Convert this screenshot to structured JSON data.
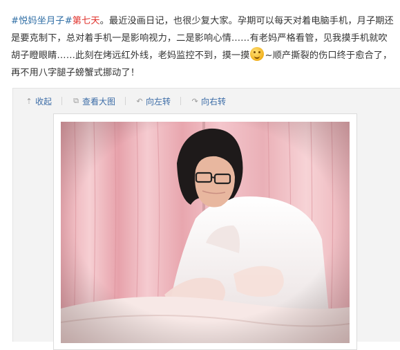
{
  "post": {
    "topic": "#悦妈坐月子#",
    "highlight": "第七天",
    "text_part1": "。最近没画日记，也很少复大家。孕期可以每天对着电脑手机，月子期还是要克制下，总对着手机一是影响视力，二是影响心情……有老妈严格看管，见我摸手机就吹胡子瞪眼睛……此刻在烤远红外线，老妈监控不到，摸一摸",
    "emoji_icon": "shy-emoji",
    "text_part2": "~顺产撕裂的伤口终于愈合了，再不用八字腿子螃蟹式挪动了！"
  },
  "toolbar": {
    "collapse": "收起",
    "view_large": "查看大图",
    "rotate_left": "向左转",
    "rotate_right": "向右转"
  },
  "colors": {
    "link": "#3d6da7",
    "topic": "#2f6ea5",
    "highlight": "#e0312b",
    "background": "#ffffff",
    "media_bg": "#f3f3f3"
  }
}
